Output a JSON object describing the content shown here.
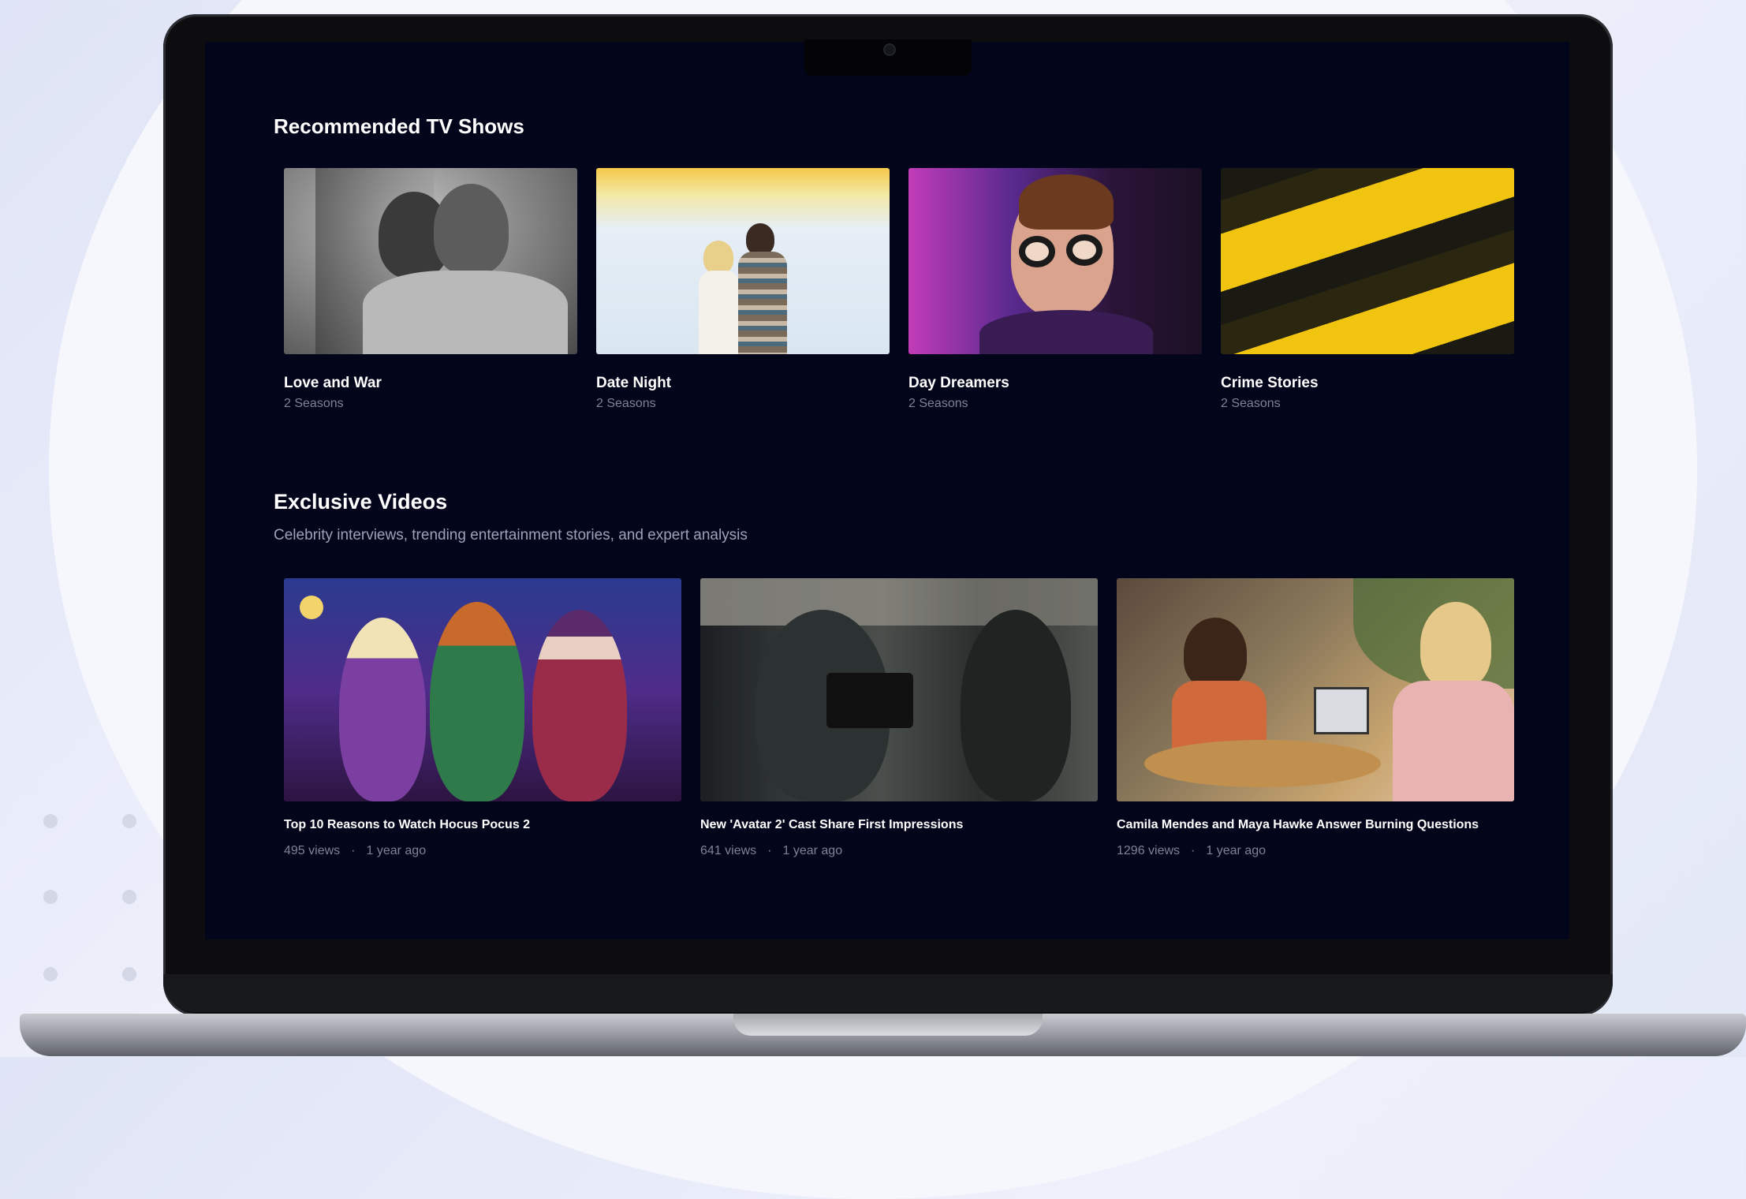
{
  "sections": {
    "recommended": {
      "title": "Recommended TV Shows",
      "shows": [
        {
          "title": "Love and War",
          "seasons": "2 Seasons"
        },
        {
          "title": "Date Night",
          "seasons": "2 Seasons"
        },
        {
          "title": "Day Dreamers",
          "seasons": "2 Seasons"
        },
        {
          "title": "Crime Stories",
          "seasons": "2 Seasons"
        }
      ]
    },
    "exclusive": {
      "title": "Exclusive Videos",
      "subtitle": "Celebrity interviews, trending entertainment stories, and expert analysis",
      "videos": [
        {
          "title": "Top 10 Reasons to Watch Hocus Pocus 2",
          "views": "495 views",
          "age": "1 year ago"
        },
        {
          "title": "New 'Avatar 2' Cast Share First Impressions",
          "views": "641 views",
          "age": "1 year ago"
        },
        {
          "title": "Camila Mendes and Maya Hawke Answer Burning Questions",
          "views": "1296 views",
          "age": "1 year ago"
        }
      ]
    }
  },
  "meta_separator": "·",
  "colors": {
    "screen_background": "#03051a",
    "heading_text": "#ffffff",
    "muted_text": "#7e8398"
  }
}
